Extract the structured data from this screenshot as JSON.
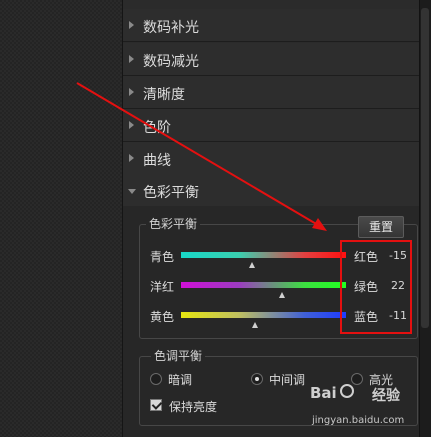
{
  "menu": {
    "items": [
      {
        "label": "数码补光",
        "expanded": false
      },
      {
        "label": "数码减光",
        "expanded": false
      },
      {
        "label": "清晰度",
        "expanded": false
      },
      {
        "label": "色阶",
        "expanded": false
      },
      {
        "label": "曲线",
        "expanded": false
      },
      {
        "label": "色彩平衡",
        "expanded": true
      }
    ]
  },
  "color_balance": {
    "group_title": "色彩平衡",
    "reset_label": "重置",
    "sliders": [
      {
        "left_label": "青色",
        "right_label": "红色",
        "value": "-15",
        "position": 0.43
      },
      {
        "left_label": "洋红",
        "right_label": "绿色",
        "value": "22",
        "position": 0.61
      },
      {
        "left_label": "黄色",
        "right_label": "蓝色",
        "value": "-11",
        "position": 0.45
      }
    ]
  },
  "tone_balance": {
    "group_title": "色调平衡",
    "options": [
      {
        "label": "暗调",
        "selected": false
      },
      {
        "label": "中间调",
        "selected": true
      },
      {
        "label": "高光",
        "selected": false
      }
    ],
    "preserve_label": "保持亮度",
    "preserve_checked": true
  },
  "watermark": {
    "logo": "Bai",
    "logo_suffix": "经验",
    "url": "jingyan.baidu.com"
  },
  "colors": {
    "annotation_red": "#e41010",
    "panel_bg": "#2b2b2b"
  }
}
